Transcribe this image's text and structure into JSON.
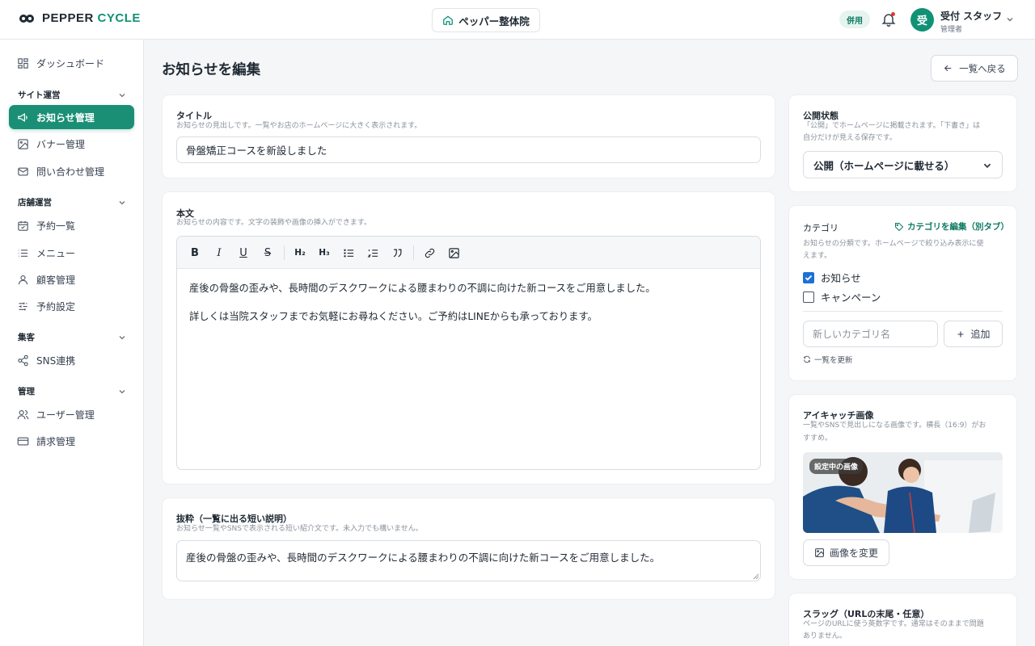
{
  "brand": {
    "name_part1": "PEPPER",
    "name_part2": "CYCLE",
    "accent": "#119176"
  },
  "header": {
    "store_name": "ペッパー整体院",
    "pill": "併用",
    "avatar_char": "受",
    "user_name": "受付 スタッフ",
    "user_role": "管理者"
  },
  "sidebar": {
    "dashboard": "ダッシュボード",
    "sections": [
      {
        "title": "サイト運営",
        "items": [
          "お知らせ管理",
          "バナー管理",
          "問い合わせ管理"
        ]
      },
      {
        "title": "店舗運営",
        "items": [
          "予約一覧",
          "メニュー",
          "顧客管理",
          "予約設定"
        ]
      },
      {
        "title": "集客",
        "items": [
          "SNS連携"
        ]
      },
      {
        "title": "管理",
        "items": [
          "ユーザー管理",
          "請求管理"
        ]
      }
    ]
  },
  "page": {
    "title": "お知らせを編集",
    "back_label": "一覧へ戻る"
  },
  "title_field": {
    "label": "タイトル",
    "hint": "お知らせの見出しです。一覧やお店のホームページに大きく表示されます。",
    "value": "骨盤矯正コースを新設しました"
  },
  "body_field": {
    "label": "本文",
    "hint": "お知らせの内容です。文字の装飾や画像の挿入ができます。",
    "toolbar": {
      "bold": "B",
      "italic": "I",
      "underline": "U",
      "strike": "S",
      "h2": "H₂",
      "h3": "H₃"
    },
    "paragraphs": [
      "産後の骨盤の歪みや、長時間のデスクワークによる腰まわりの不調に向けた新コースをご用意しました。",
      "詳しくは当院スタッフまでお気軽にお尋ねください。ご予約はLINEからも承っております。"
    ]
  },
  "excerpt_field": {
    "label": "抜粋（一覧に出る短い説明）",
    "hint": "お知らせ一覧やSNSで表示される短い紹介文です。未入力でも構いません。",
    "value": "産後の骨盤の歪みや、長時間のデスクワークによる腰まわりの不調に向けた新コースをご用意しました。"
  },
  "status": {
    "label": "公開状態",
    "hint_line1": "「公開」でホームページに掲載されます。「下書き」は",
    "hint_line2": "自分だけが見える保存です。",
    "selected": "公開（ホームページに載せる）"
  },
  "category": {
    "label": "カテゴリ",
    "edit_link": "カテゴリを編集（別タブ）",
    "hint_line1": "お知らせの分類です。ホームページで絞り込み表示に使",
    "hint_line2": "えます。",
    "options": [
      {
        "label": "お知らせ",
        "checked": true
      },
      {
        "label": "キャンペーン",
        "checked": false
      }
    ],
    "new_placeholder": "新しいカテゴリ名",
    "add_label": "追加",
    "refresh_label": "一覧を更新"
  },
  "eyecatch": {
    "label": "アイキャッチ画像",
    "hint_line1": "一覧やSNSで見出しになる画像です。横長（16:9）がお",
    "hint_line2": "すすめ。",
    "badge": "設定中の画像",
    "change_label": "画像を変更"
  },
  "slug": {
    "label": "スラッグ（URLの末尾・任意）",
    "hint_line1": "ページのURLに使う英数字です。通常はそのままで問題",
    "hint_line2": "ありません。"
  }
}
